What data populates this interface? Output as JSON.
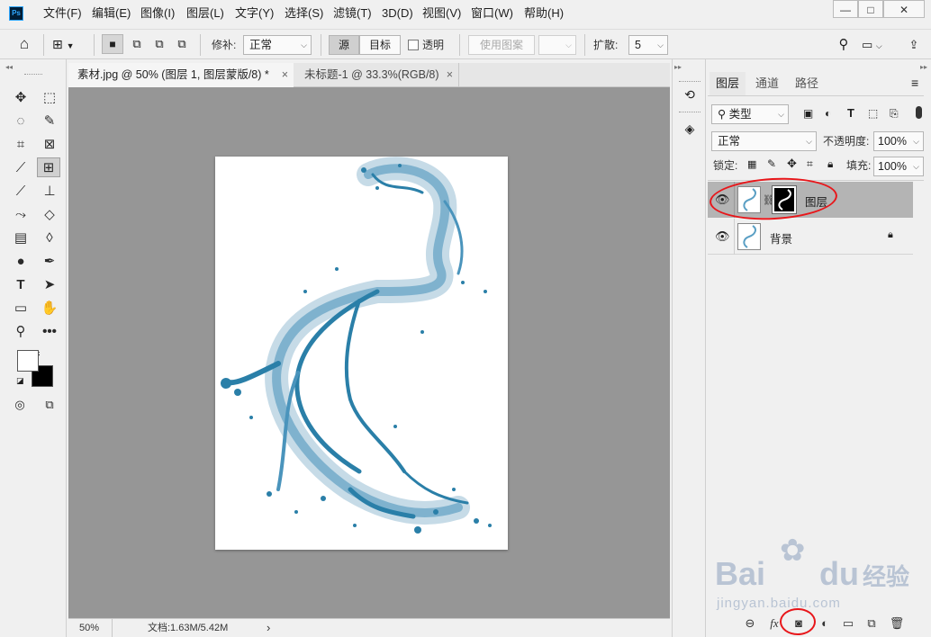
{
  "app": {
    "logo": "Ps"
  },
  "menu": [
    "文件(F)",
    "编辑(E)",
    "图像(I)",
    "图层(L)",
    "文字(Y)",
    "选择(S)",
    "滤镜(T)",
    "3D(D)",
    "视图(V)",
    "窗口(W)",
    "帮助(H)"
  ],
  "window_controls": {
    "minimize": "—",
    "restore": "□",
    "close": "✕"
  },
  "options": {
    "patch_label": "修补:",
    "patch_mode": "正常",
    "source": "源",
    "target": "目标",
    "transparent": "透明",
    "use_pattern": "使用图案",
    "diffuse_label": "扩散:",
    "diffuse_value": "5"
  },
  "tabs": [
    {
      "label": "素材.jpg @ 50% (图层 1, 图层蒙版/8) *",
      "close": "×"
    },
    {
      "label": "未标题-1 @ 33.3%(RGB/8)",
      "close": "×"
    }
  ],
  "status": {
    "zoom": "50%",
    "doc_info": "文档:1.63M/5.42M",
    "arrow": "›"
  },
  "panel": {
    "tabs": [
      "图层",
      "通道",
      "路径"
    ],
    "filter_kind": "类型",
    "blend_mode": "正常",
    "opacity_label": "不透明度:",
    "opacity_value": "100%",
    "lock_label": "锁定:",
    "fill_label": "填充:",
    "fill_value": "100%",
    "layers": [
      {
        "name": "图层",
        "selected": true,
        "has_mask": true
      },
      {
        "name": "背景",
        "selected": false,
        "locked": true
      }
    ]
  },
  "watermark": {
    "brand": "Bai",
    "brand2": "du",
    "site": "经验",
    "url": "jingyan.baidu.com"
  },
  "colors": {
    "accent": "#e8161a",
    "canvas": "#969696",
    "selected_layer": "#b4b4b4",
    "splash": "#2a7fa8"
  }
}
